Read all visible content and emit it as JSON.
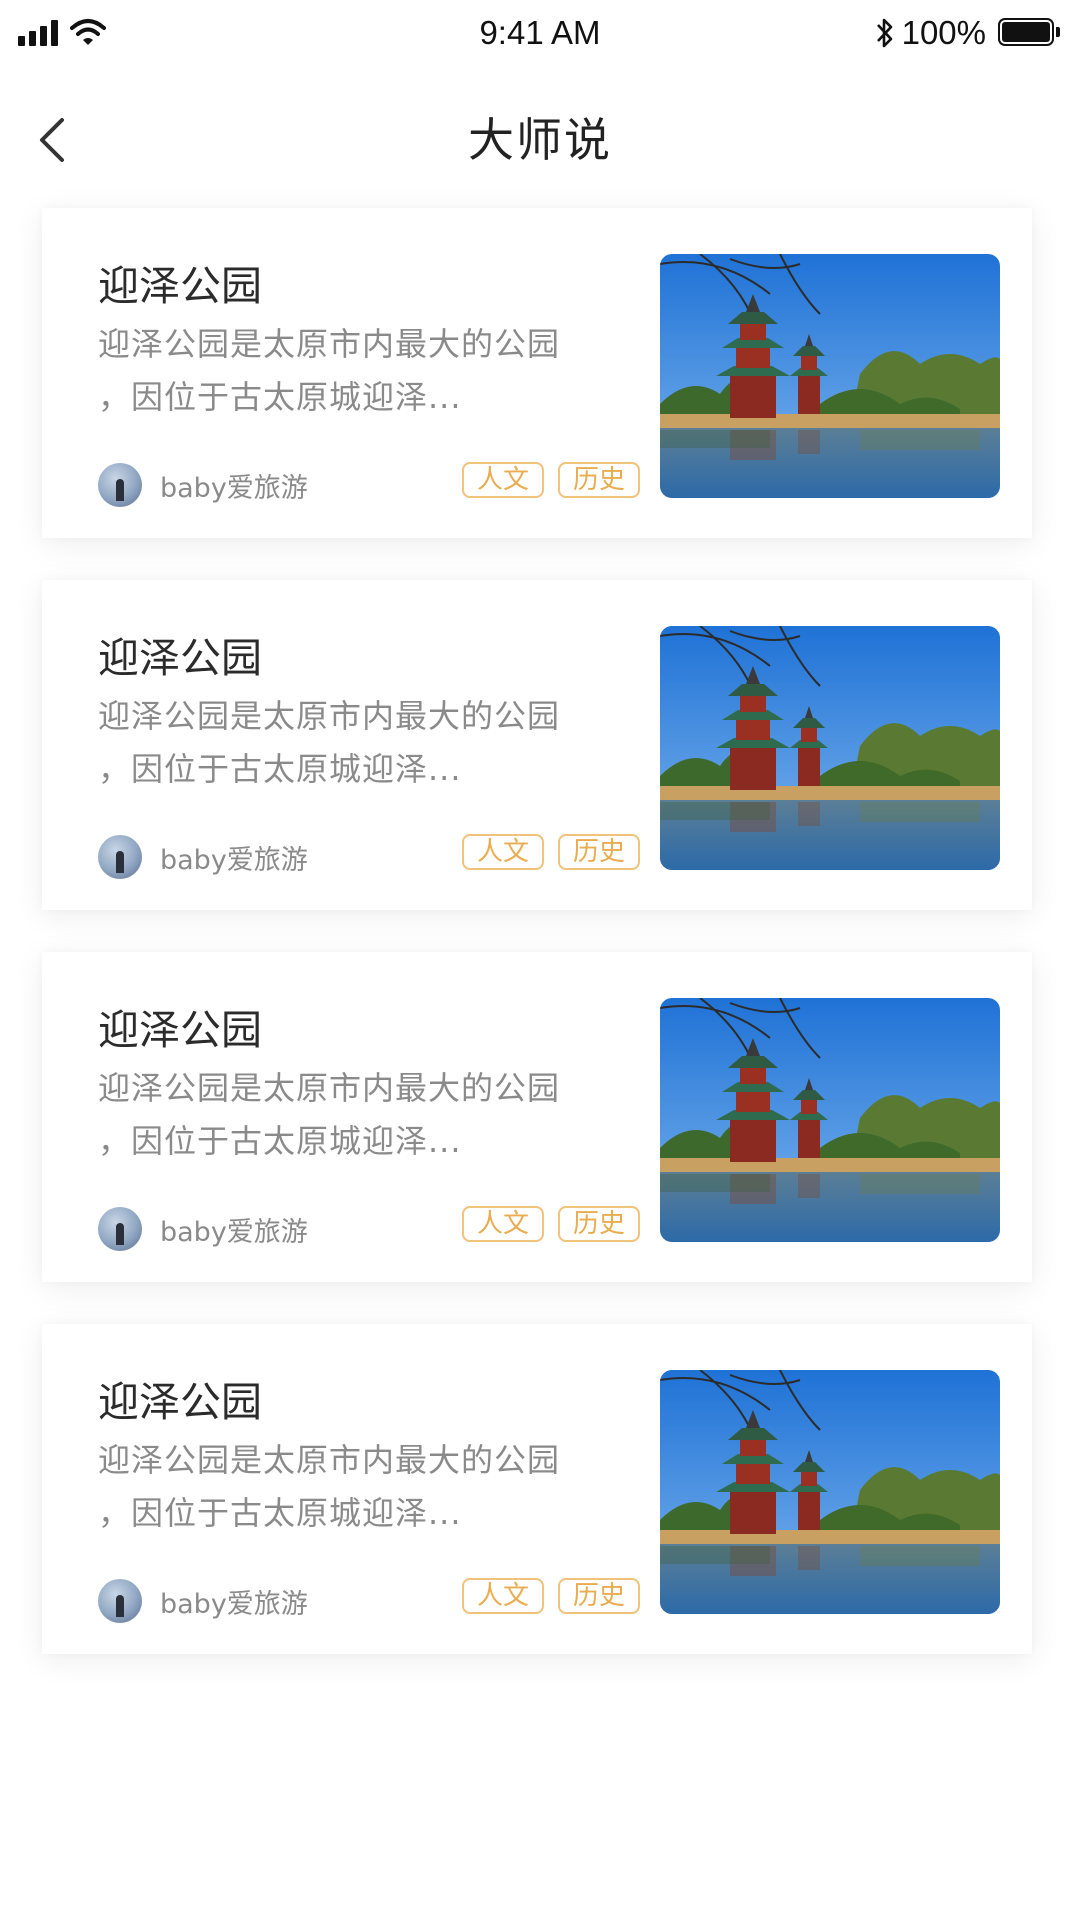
{
  "status_bar": {
    "time": "9:41 AM",
    "battery_percent": "100%",
    "icons": [
      "signal-icon",
      "wifi-icon",
      "bluetooth-icon",
      "battery-icon"
    ]
  },
  "nav": {
    "title": "大师说",
    "back_icon": "chevron-left-icon"
  },
  "colors": {
    "tag_border": "#f0c27a",
    "tag_text": "#e9ac4f",
    "title_text": "#2b2b2b",
    "desc_text": "#8a8a8a"
  },
  "articles": [
    {
      "title": "迎泽公园",
      "description": "迎泽公园是太原市内最大的公园\n，因位于古太原城迎泽...",
      "author": "baby爱旅游",
      "tags": [
        "人文",
        "历史"
      ]
    },
    {
      "title": "迎泽公园",
      "description": "迎泽公园是太原市内最大的公园\n，因位于古太原城迎泽...",
      "author": "baby爱旅游",
      "tags": [
        "人文",
        "历史"
      ]
    },
    {
      "title": "迎泽公园",
      "description": "迎泽公园是太原市内最大的公园\n，因位于古太原城迎泽...",
      "author": "baby爱旅游",
      "tags": [
        "人文",
        "历史"
      ]
    },
    {
      "title": "迎泽公园",
      "description": "迎泽公园是太原市内最大的公园\n，因位于古太原城迎泽...",
      "author": "baby爱旅游",
      "tags": [
        "人文",
        "历史"
      ]
    }
  ]
}
